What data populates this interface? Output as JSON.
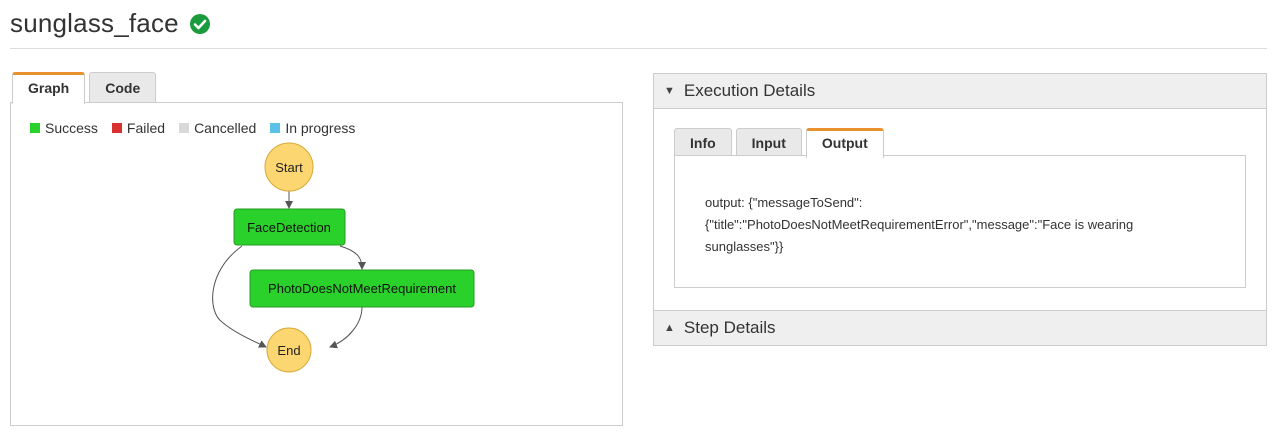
{
  "header": {
    "title": "sunglass_face",
    "status_icon": "check-circle-icon",
    "status_color": "#1a9c3e"
  },
  "graph_tabs": [
    {
      "label": "Graph"
    },
    {
      "label": "Code"
    }
  ],
  "legend": [
    {
      "label": "Success",
      "color": "#2bd12b"
    },
    {
      "label": "Failed",
      "color": "#d93030"
    },
    {
      "label": "Cancelled",
      "color": "#d9d9d9"
    },
    {
      "label": "In progress",
      "color": "#5bc2e7"
    }
  ],
  "graph": {
    "nodes": {
      "start": "Start",
      "face_detection": "FaceDetection",
      "photo_req": "PhotoDoesNotMeetRequirement",
      "end": "End"
    },
    "colors": {
      "terminal": "#fcd670",
      "success": "#2bd12b"
    }
  },
  "execution_details": {
    "title": "Execution Details",
    "tabs": [
      {
        "label": "Info"
      },
      {
        "label": "Input"
      },
      {
        "label": "Output"
      }
    ],
    "output_line1": "output: {\"messageToSend\":",
    "output_line2": "{\"title\":\"PhotoDoesNotMeetRequirementError\",\"message\":\"Face is wearing",
    "output_line3": "sunglasses\"}}"
  },
  "step_details": {
    "title": "Step Details"
  },
  "accent_color": "#e8912e"
}
